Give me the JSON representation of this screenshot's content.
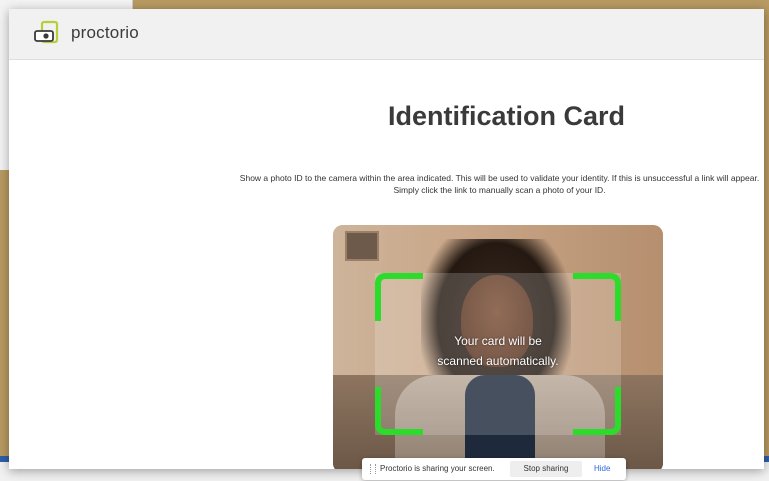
{
  "app": {
    "brand": "proctorio"
  },
  "page": {
    "title": "Identification Card",
    "instructions": "Show a photo ID to the camera within the area indicated. This will be used to validate your identity. If this is unsuccessful a link will appear. Simply click the link to manually scan a photo of your ID."
  },
  "camera": {
    "scan_line1": "Your card will be",
    "scan_line2": "scanned automatically."
  },
  "share_bar": {
    "message": "Proctorio is sharing your screen.",
    "stop_label": "Stop sharing",
    "hide_label": "Hide"
  },
  "colors": {
    "accent_green": "#2bdc2b",
    "link_blue": "#2b6be0"
  },
  "icons": {
    "logo": "proctorio-logo-icon"
  }
}
